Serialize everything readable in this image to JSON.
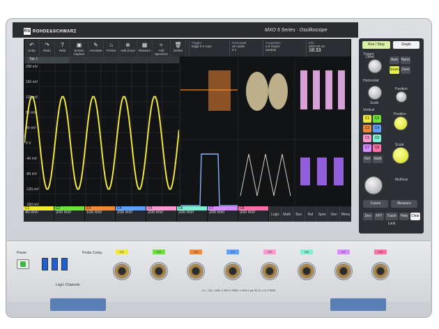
{
  "brand": "ROHDE&SCHWARZ",
  "series_title": "MXO 5 Series · Oscilloscope",
  "model_info": "MXO58   2 GHz · 12-bit ADC",
  "toolbar": [
    {
      "label": "Undo",
      "icon": "↶"
    },
    {
      "label": "Redo",
      "icon": "↷"
    },
    {
      "label": "Help",
      "icon": "?"
    },
    {
      "label": "Screen Capture",
      "icon": "▣"
    },
    {
      "label": "Annotate",
      "icon": "✎"
    },
    {
      "label": "Preset",
      "icon": "⌂"
    },
    {
      "label": "Add Zoom",
      "icon": "⊕"
    },
    {
      "label": "Measure",
      "icon": "▦"
    },
    {
      "label": "Add Spectrum",
      "icon": "≈"
    },
    {
      "label": "Delete",
      "icon": "🗑"
    }
  ],
  "info": {
    "trigger": {
      "title": "Trigger",
      "mode": "Edge",
      "level": "0 V",
      "type": "Auto"
    },
    "horizontal": {
      "title": "Horizontal",
      "scale": "40 ns/div",
      "delay": "0 s"
    },
    "acquisition": {
      "title": "Acquisition",
      "rate": "2.5 GSa/s",
      "mode": "Sample"
    },
    "info": {
      "title": "Info",
      "date": "2023-02-24",
      "time": "18:33"
    }
  },
  "tab_label": "Tab 1",
  "main_plot": {
    "y_labels": [
      "200 mV",
      "160 mV",
      "120 mV",
      "80 mV",
      "40 mV",
      "0 V",
      "-40 mV",
      "-80 mV",
      "-120 mV",
      "-160 mV",
      "-200 mV"
    ],
    "x_labels": [
      "-160 ns",
      "-120 ns",
      "-80 ns",
      "-40 ns",
      "0 s",
      "40 ns",
      "80 ns",
      "120 ns",
      "160 ns"
    ]
  },
  "channels": [
    {
      "name": "C1",
      "color": "#f0e83a",
      "value": "40 mV/"
    },
    {
      "name": "C2",
      "color": "#6fe23a",
      "value": "200 mV/"
    },
    {
      "name": "C3",
      "color": "#f08a35",
      "value": "100 mV/"
    },
    {
      "name": "C4",
      "color": "#5fa0ff",
      "value": "200 mV/"
    },
    {
      "name": "C5",
      "color": "#ff9ad0",
      "value": "200 mV/"
    },
    {
      "name": "C6",
      "color": "#7ff0d2",
      "value": "200 mV/"
    },
    {
      "name": "C7",
      "color": "#d58cff",
      "value": "200 mV/"
    },
    {
      "name": "C8",
      "color": "#ff6fa8",
      "value": "200 mV/"
    }
  ],
  "menu_items": [
    "Logic",
    "Math",
    "Bus",
    "Ref",
    "Spec",
    "Gen",
    "Menu"
  ],
  "side_panel": {
    "run_stop": "Run / Stop",
    "single": "Single",
    "trigger_label": "Trigger",
    "level": "Level",
    "auto": "Auto",
    "norm": "Norm",
    "source": "Source",
    "zone": "Zone",
    "horizontal_label": "Horizontal",
    "scale": "Scale",
    "position": "Position",
    "vertical_label": "Vertical",
    "position_v": "Position",
    "scale_v": "Scale",
    "ref": "Ref",
    "math": "Math",
    "multiuse": "Multiuse",
    "cursor": "Cursor",
    "measure": "Measure",
    "bottom": [
      "Dev",
      "FFT",
      "Touch Lock",
      "Help",
      "Clear"
    ]
  },
  "front": {
    "power": "Power",
    "probe_comp": "Probe Comp.",
    "logic_channels": "Logic Channels",
    "channel_labels": [
      "C1",
      "C2",
      "C3",
      "C4",
      "C5",
      "C6",
      "C7",
      "C8"
    ],
    "warning": "C1 - C8: 1 MΩ, ≤ 300 V RMS, ≤ 400 V pk; 50 Ω, ≤ 5 V RMS"
  },
  "colors": {
    "c1": "#f0e83a",
    "c2": "#6fe23a",
    "c3": "#f08a35",
    "c4": "#5fa0ff",
    "purple": "#b06cff"
  }
}
